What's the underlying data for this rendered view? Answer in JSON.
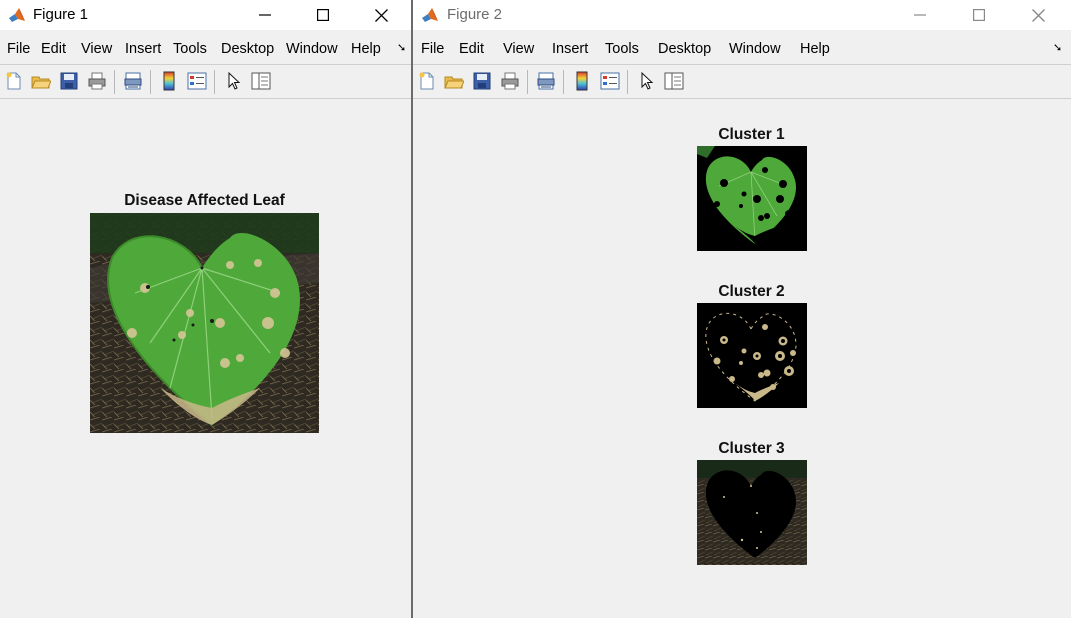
{
  "figure1": {
    "title": "Figure 1",
    "menu": [
      "File",
      "Edit",
      "View",
      "Insert",
      "Tools",
      "Desktop",
      "Window",
      "Help"
    ],
    "axes_title": "Disease Affected Leaf"
  },
  "figure2": {
    "title": "Figure 2",
    "menu": [
      "File",
      "Edit",
      "View",
      "Insert",
      "Tools",
      "Desktop",
      "Window",
      "Help"
    ],
    "clusters": [
      {
        "title": "Cluster 1"
      },
      {
        "title": "Cluster 2"
      },
      {
        "title": "Cluster 3"
      }
    ]
  },
  "icons": {
    "app": "matlab-logo-icon",
    "minimize": "minimize-icon",
    "maximize": "maximize-icon",
    "close": "close-icon",
    "toolbar": [
      "new-figure-icon",
      "open-file-icon",
      "save-icon",
      "print-icon",
      "print-preview-icon",
      "colorbar-icon",
      "legend-icon",
      "pointer-icon",
      "property-editor-icon"
    ]
  },
  "colors": {
    "leaf_green": "#4fa83a",
    "disease_tan": "#c9b88a",
    "background_black": "#000000"
  }
}
